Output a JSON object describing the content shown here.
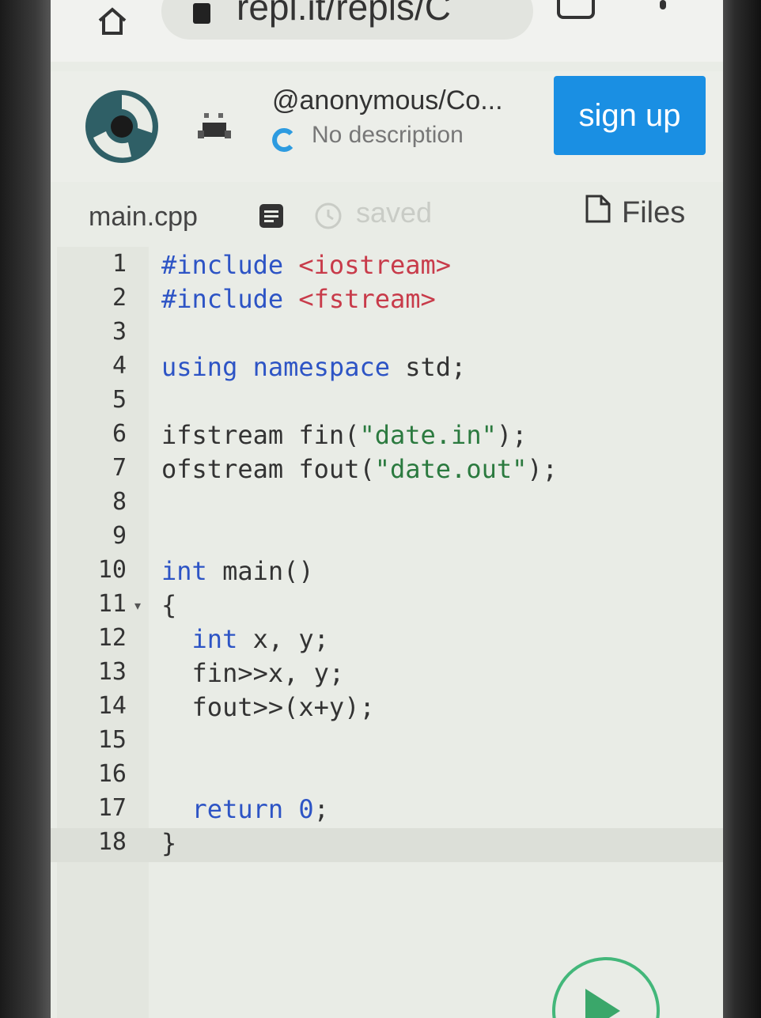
{
  "browser": {
    "url": "repl.it/repls/C",
    "icons": [
      "home-icon",
      "lock-icon",
      "tabs-icon",
      "menu-icon"
    ]
  },
  "repl": {
    "name": "@anonymous/Co...",
    "description": "No description",
    "signup_label": "sign up",
    "accent_color": "#1a8fe3"
  },
  "editor": {
    "filename": "main.cpp",
    "status": "saved",
    "files_label": "Files",
    "active_line": 18,
    "lines": [
      {
        "n": "1",
        "code": "#include <iostream>"
      },
      {
        "n": "2",
        "code": "#include <fstream>"
      },
      {
        "n": "3",
        "code": ""
      },
      {
        "n": "4",
        "code": "using namespace std;"
      },
      {
        "n": "5",
        "code": ""
      },
      {
        "n": "6",
        "code": "ifstream fin(\"date.in\");"
      },
      {
        "n": "7",
        "code": "ofstream fout(\"date.out\");"
      },
      {
        "n": "8",
        "code": ""
      },
      {
        "n": "9",
        "code": ""
      },
      {
        "n": "10",
        "code": "int main()"
      },
      {
        "n": "11",
        "code": "{"
      },
      {
        "n": "12",
        "code": "  int x, y;"
      },
      {
        "n": "13",
        "code": "  fin>>x, y;"
      },
      {
        "n": "14",
        "code": "  fout>>(x+y);"
      },
      {
        "n": "15",
        "code": ""
      },
      {
        "n": "16",
        "code": ""
      },
      {
        "n": "17",
        "code": "  return 0;"
      },
      {
        "n": "18",
        "code": "}"
      }
    ]
  }
}
